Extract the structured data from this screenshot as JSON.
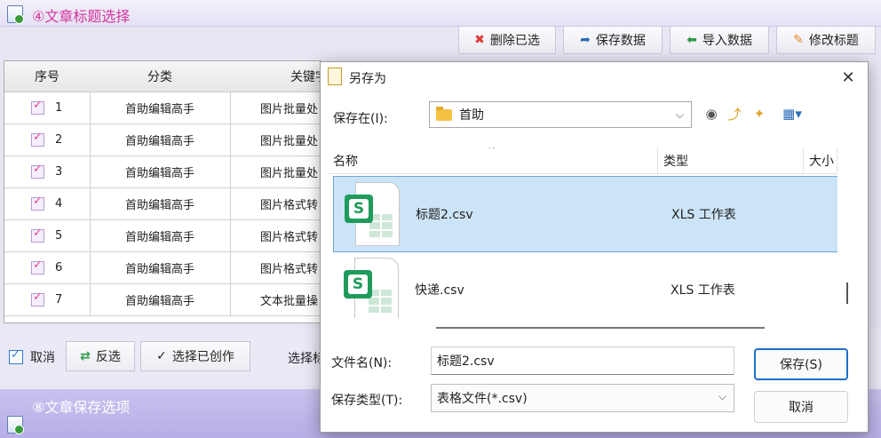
{
  "section1": {
    "title": "④文章标题选择"
  },
  "toolbar": {
    "delete_label": "删除已选",
    "save_label": "保存数据",
    "import_label": "导入数据",
    "edit_label": "修改标题"
  },
  "grid": {
    "headers": [
      "序号",
      "分类",
      "关键字"
    ],
    "rows": [
      {
        "no": "1",
        "category": "首助编辑高手",
        "keyword": "图片批量处"
      },
      {
        "no": "2",
        "category": "首助编辑高手",
        "keyword": "图片批量处"
      },
      {
        "no": "3",
        "category": "首助编辑高手",
        "keyword": "图片批量处"
      },
      {
        "no": "4",
        "category": "首助编辑高手",
        "keyword": "图片格式转"
      },
      {
        "no": "5",
        "category": "首助编辑高手",
        "keyword": "图片格式转"
      },
      {
        "no": "6",
        "category": "首助编辑高手",
        "keyword": "图片格式转"
      },
      {
        "no": "7",
        "category": "首助编辑高手",
        "keyword": "文本批量操"
      }
    ]
  },
  "bottom_bar": {
    "cancel_label": "取消",
    "invert_label": "反选",
    "select_created_label": "选择已创作",
    "select_partial": "选择标"
  },
  "section2": {
    "title": "⑧文章保存选项"
  },
  "dialog": {
    "title": "另存为",
    "save_in_label": "保存在(I):",
    "save_in_value": "首助",
    "columns": {
      "name": "名称",
      "type": "类型",
      "size": "大小"
    },
    "files": [
      {
        "name": "标题2.csv",
        "type": "XLS 工作表",
        "selected": true
      },
      {
        "name": "快递.csv",
        "type": "XLS 工作表",
        "selected": false
      }
    ],
    "file_name_label": "文件名(N):",
    "file_name_value": "标题2.csv",
    "file_type_label": "保存类型(T):",
    "file_type_value": "表格文件(*.csv)",
    "save_button": "保存(S)",
    "cancel_button": "取消"
  }
}
